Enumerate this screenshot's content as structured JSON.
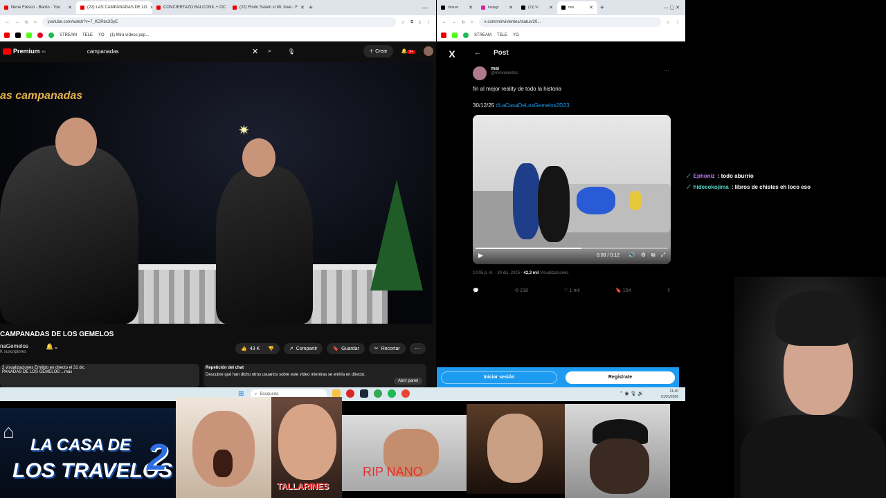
{
  "left_browser": {
    "tabs": [
      {
        "label": "Nene Fresco - Barrio · You"
      },
      {
        "label": "(22) LAS CAMPANADAS DE LO"
      },
      {
        "label": "CONCIERTAZO BALCONIL + OC"
      },
      {
        "label": "(22) Florin Salam si Mr Juve - F"
      }
    ],
    "url": "youtube.com/watch?v=7_KDRbc3SyE",
    "bookmarks": [
      "STREAM",
      "TELE",
      "YO",
      "(1) Mira vídeos pop..."
    ]
  },
  "youtube": {
    "logo": "Premium",
    "logo_region": "ES",
    "search_value": "campanadas",
    "create_label": "Crear",
    "notif_badge": "9+",
    "video_overlay_title": "as campanadas",
    "video_title": "CAMPANADAS DE LOS GEMELOS",
    "channel": "naGemelos",
    "subscribers": "K suscriptores",
    "likes": "43 K",
    "share": "Compartir",
    "save": "Guardar",
    "clip": "Recortar",
    "desc_line1": "2 visualizaciones  Emitido en directo el 31 dic",
    "desc_line2": "PANADAS DE LOS GEMELOS ...más",
    "chat_title": "Repetición del chat",
    "chat_desc": "Descubre qué han dicho otros usuarios sobre este vídeo mientras se emitía en directo.",
    "chat_open": "Abrir panel"
  },
  "right_browser": {
    "tabs": [
      {
        "label": "charun"
      },
      {
        "label": "Instagr"
      },
      {
        "label": "(13) Vi"
      },
      {
        "label": "mai"
      }
    ],
    "url": "x.com/mirivivientes/status/20...",
    "bookmarks": [
      "STREAM",
      "TELE",
      "YO"
    ]
  },
  "x_post": {
    "logo": "X",
    "header": "Post",
    "user_name": "mai",
    "user_handle": "@mirivivientes",
    "text": "fin al mejor reality de todo la historia",
    "date_line": "30/12/25",
    "hashtag": "#LaCasaDeLosGemelos2D23",
    "video_time": "0:08 / 0:12",
    "video_progress": 0.55,
    "meta_time": "10:05 p. m. · 30 dic. 2025 ·",
    "views_count": "42,3 mil",
    "views_label": "Visualizaciones",
    "reposts": "218",
    "likes": "1 mil",
    "bookmarks": "154",
    "login": "Iniciar sesión",
    "register": "Regístrate"
  },
  "taskbar": {
    "search_placeholder": "Búsqueda",
    "time": "21:40",
    "date": "01/01/2026"
  },
  "chat_overlay": [
    {
      "user": "Ephoniz",
      "color": "#b57cf0",
      "message": ": todo aburrio"
    },
    {
      "user": "hideeokojima",
      "color": "#58d6c8",
      "message": ": libros de chistes eh loco eso"
    }
  ],
  "bottom_strip": {
    "logo_line1": "LA CASA DE",
    "logo_line2": "LOS TRAVELOS",
    "logo_number": "2",
    "caption_tallarines": "TALLARINES",
    "caption_rip": "RIP NANO"
  }
}
